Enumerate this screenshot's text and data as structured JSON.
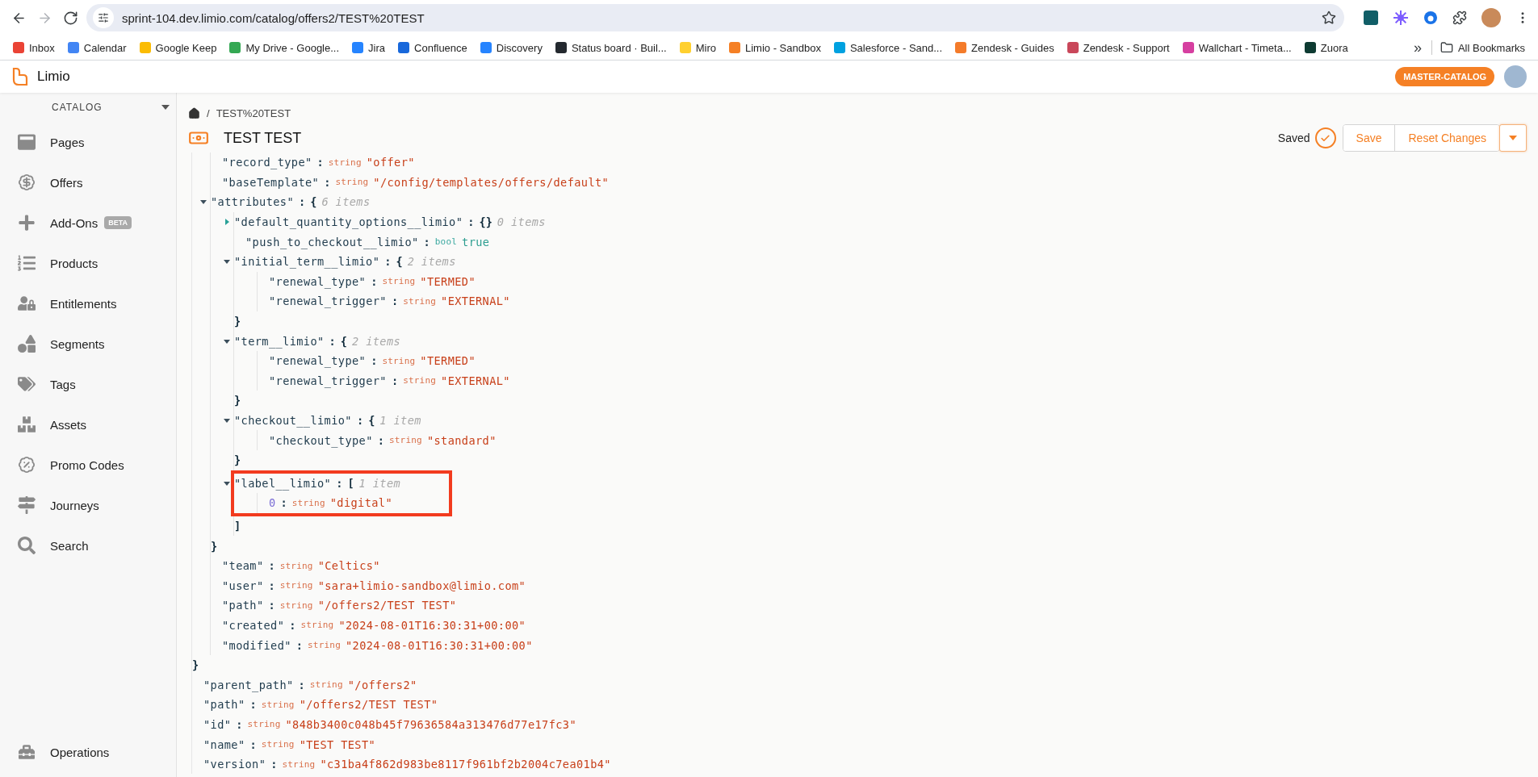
{
  "browser": {
    "nav_buttons": [
      {
        "disabled": false
      },
      {
        "disabled": true
      },
      {
        "disabled": false
      }
    ],
    "url": "sprint-104.dev.limio.com/catalog/offers2/TEST%20TEST",
    "bookmarks": [
      {
        "label": "Inbox",
        "color": "#ea4335"
      },
      {
        "label": "Calendar",
        "color": "#4285f4"
      },
      {
        "label": "Google Keep",
        "color": "#fbbc04"
      },
      {
        "label": "My Drive - Google...",
        "color": "#34a853"
      },
      {
        "label": "Jira",
        "color": "#2684ff"
      },
      {
        "label": "Confluence",
        "color": "#1868db"
      },
      {
        "label": "Discovery",
        "color": "#2684ff"
      },
      {
        "label": "Status board · Buil...",
        "color": "#24292f"
      },
      {
        "label": "Miro",
        "color": "#ffd02f"
      },
      {
        "label": "Limio - Sandbox",
        "color": "#f58025"
      },
      {
        "label": "Salesforce - Sand...",
        "color": "#00a1e0"
      },
      {
        "label": "Zendesk - Guides",
        "color": "#f47b2a"
      },
      {
        "label": "Zendesk - Support",
        "color": "#c9475a"
      },
      {
        "label": "Wallchart - Timeta...",
        "color": "#d63fa0"
      },
      {
        "label": "Zuora",
        "color": "#0e3b32"
      }
    ],
    "overflow": "»",
    "all_bookmarks": "All Bookmarks"
  },
  "app_header": {
    "brand": "Limio",
    "catalog_badge": "MASTER-CATALOG"
  },
  "sidebar": {
    "header": "CATALOG",
    "items": [
      {
        "label": "Pages"
      },
      {
        "label": "Offers"
      },
      {
        "label": "Add-Ons",
        "badge": "BETA"
      },
      {
        "label": "Products"
      },
      {
        "label": "Entitlements"
      },
      {
        "label": "Segments"
      },
      {
        "label": "Tags"
      },
      {
        "label": "Assets"
      },
      {
        "label": "Promo Codes"
      },
      {
        "label": "Journeys"
      },
      {
        "label": "Search"
      }
    ],
    "footer_item": {
      "label": "Operations"
    }
  },
  "page": {
    "breadcrumb": {
      "separator": "/",
      "current": "TEST%20TEST"
    },
    "title": "TEST TEST",
    "status": "Saved",
    "buttons": [
      {
        "label": "Save"
      },
      {
        "label": "Reset Changes"
      }
    ]
  },
  "json_view": {
    "separator": ":",
    "nodes": [
      {
        "kind": "object",
        "close": "}",
        "children": [
          {
            "kind": "string",
            "key": "\"record_type\"",
            "type": "string",
            "value": "\"offer\""
          },
          {
            "kind": "string",
            "key": "\"baseTemplate\"",
            "type": "string",
            "value": "\"/config/templates/offers/default\""
          },
          {
            "kind": "object",
            "key": "\"attributes\"",
            "open": "{",
            "count": "6 items",
            "expanded": true,
            "close": "}",
            "children": [
              {
                "kind": "object",
                "key": "\"default_quantity_options__limio\"",
                "open": "{}",
                "count": "0 items",
                "expanded": false
              },
              {
                "kind": "bool",
                "key": "\"push_to_checkout__limio\"",
                "type": "bool",
                "value": "true"
              },
              {
                "kind": "object",
                "key": "\"initial_term__limio\"",
                "open": "{",
                "count": "2 items",
                "expanded": true,
                "close": "}",
                "children": [
                  {
                    "kind": "string",
                    "key": "\"renewal_type\"",
                    "type": "string",
                    "value": "\"TERMED\""
                  },
                  {
                    "kind": "string",
                    "key": "\"renewal_trigger\"",
                    "type": "string",
                    "value": "\"EXTERNAL\""
                  }
                ]
              },
              {
                "kind": "object",
                "key": "\"term__limio\"",
                "open": "{",
                "count": "2 items",
                "expanded": true,
                "close": "}",
                "children": [
                  {
                    "kind": "string",
                    "key": "\"renewal_type\"",
                    "type": "string",
                    "value": "\"TERMED\""
                  },
                  {
                    "kind": "string",
                    "key": "\"renewal_trigger\"",
                    "type": "string",
                    "value": "\"EXTERNAL\""
                  }
                ]
              },
              {
                "kind": "object",
                "key": "\"checkout__limio\"",
                "open": "{",
                "count": "1 item",
                "expanded": true,
                "close": "}",
                "children": [
                  {
                    "kind": "string",
                    "key": "\"checkout_type\"",
                    "type": "string",
                    "value": "\"standard\""
                  }
                ]
              },
              {
                "kind": "array",
                "key": "\"label__limio\"",
                "open": "[",
                "count": "1 item",
                "expanded": true,
                "highlighted": true,
                "close": "]",
                "children": [
                  {
                    "kind": "string",
                    "index": "0",
                    "type": "string",
                    "value": "\"digital\""
                  }
                ]
              }
            ]
          },
          {
            "kind": "string",
            "key": "\"team\"",
            "type": "string",
            "value": "\"Celtics\""
          },
          {
            "kind": "string",
            "key": "\"user\"",
            "type": "string",
            "value": "\"sara+limio-sandbox@limio.com\""
          },
          {
            "kind": "string",
            "key": "\"path\"",
            "type": "string",
            "value": "\"/offers2/TEST TEST\""
          },
          {
            "kind": "string",
            "key": "\"created\"",
            "type": "string",
            "value": "\"2024-08-01T16:30:31+00:00\""
          },
          {
            "kind": "string",
            "key": "\"modified\"",
            "type": "string",
            "value": "\"2024-08-01T16:30:31+00:00\""
          }
        ]
      },
      {
        "kind": "string",
        "key": "\"parent_path\"",
        "type": "string",
        "value": "\"/offers2\""
      },
      {
        "kind": "string",
        "key": "\"path\"",
        "type": "string",
        "value": "\"/offers2/TEST TEST\""
      },
      {
        "kind": "string",
        "key": "\"id\"",
        "type": "string",
        "value": "\"848b3400c048b45f79636584a313476d77e17fc3\""
      },
      {
        "kind": "string",
        "key": "\"name\"",
        "type": "string",
        "value": "\"TEST TEST\""
      },
      {
        "kind": "string",
        "key": "\"version\"",
        "type": "string",
        "value": "\"c31ba4f862d983be8117f961bf2b2004c7ea01b4\""
      }
    ]
  }
}
